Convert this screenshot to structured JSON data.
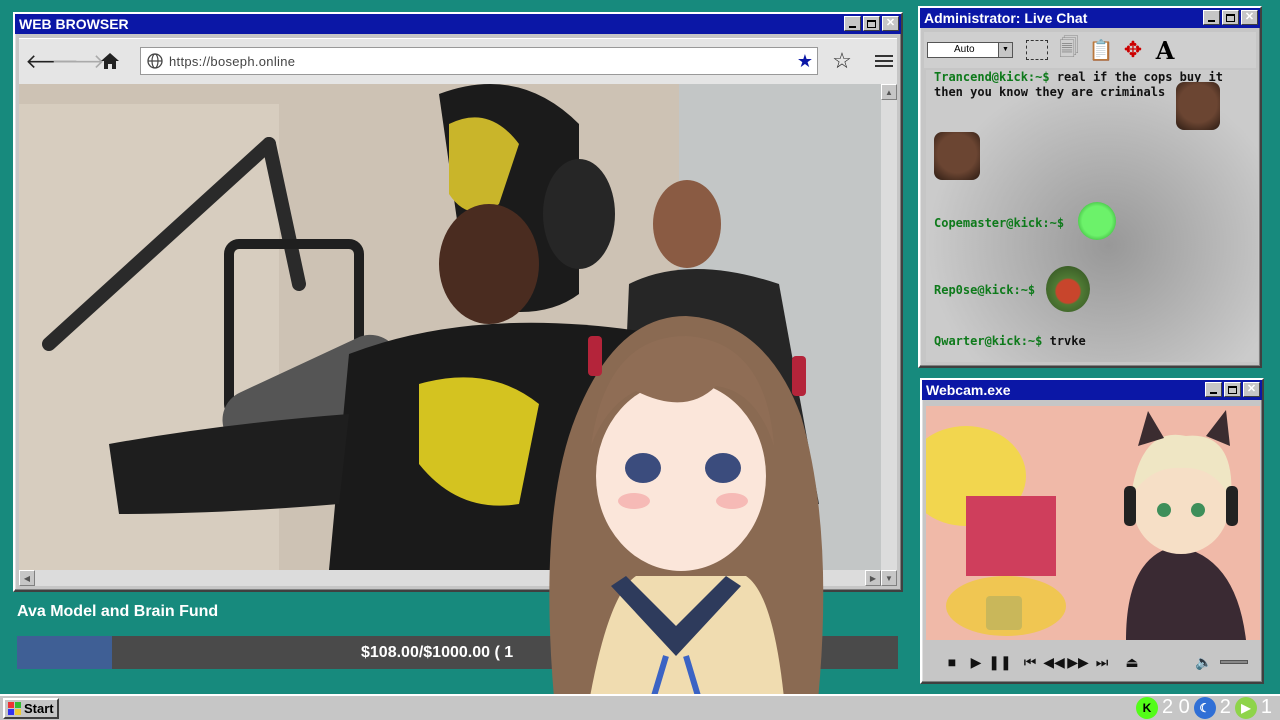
{
  "browser": {
    "title": "WEB BROWSER",
    "url": "https://boseph.online",
    "icons": [
      "back-arrow-icon",
      "forward-arrow-icon",
      "home-icon",
      "globe-icon",
      "star-filled-icon",
      "star-outline-icon",
      "hamburger-menu-icon"
    ]
  },
  "chat": {
    "title": "Administrator: Live Chat",
    "select_value": "Auto",
    "messages": [
      {
        "user": "Trancend@kick:~$",
        "text": "real if the cops buy it then you know they are criminals"
      },
      {
        "user": "Copemaster@kick:~$",
        "text": ""
      },
      {
        "user": "Rep0se@kick:~$",
        "text": ""
      },
      {
        "user": "Qwarter@kick:~$",
        "text": "trvke"
      }
    ]
  },
  "webcam": {
    "title": "Webcam.exe"
  },
  "fund": {
    "title": "Ava Model and Brain Fund",
    "progress_text": "$108.00/$1000.00 ( 1",
    "raised": 108.0,
    "goal": 1000.0
  },
  "taskbar": {
    "start_label": "Start",
    "tray_values": [
      "2 0",
      "2",
      "1"
    ]
  },
  "colors": {
    "desktop": "#178a7d",
    "titlebar": "#0b17a6",
    "fund_fill": "#3f5f95",
    "chat_user": "#0e7a1b"
  }
}
